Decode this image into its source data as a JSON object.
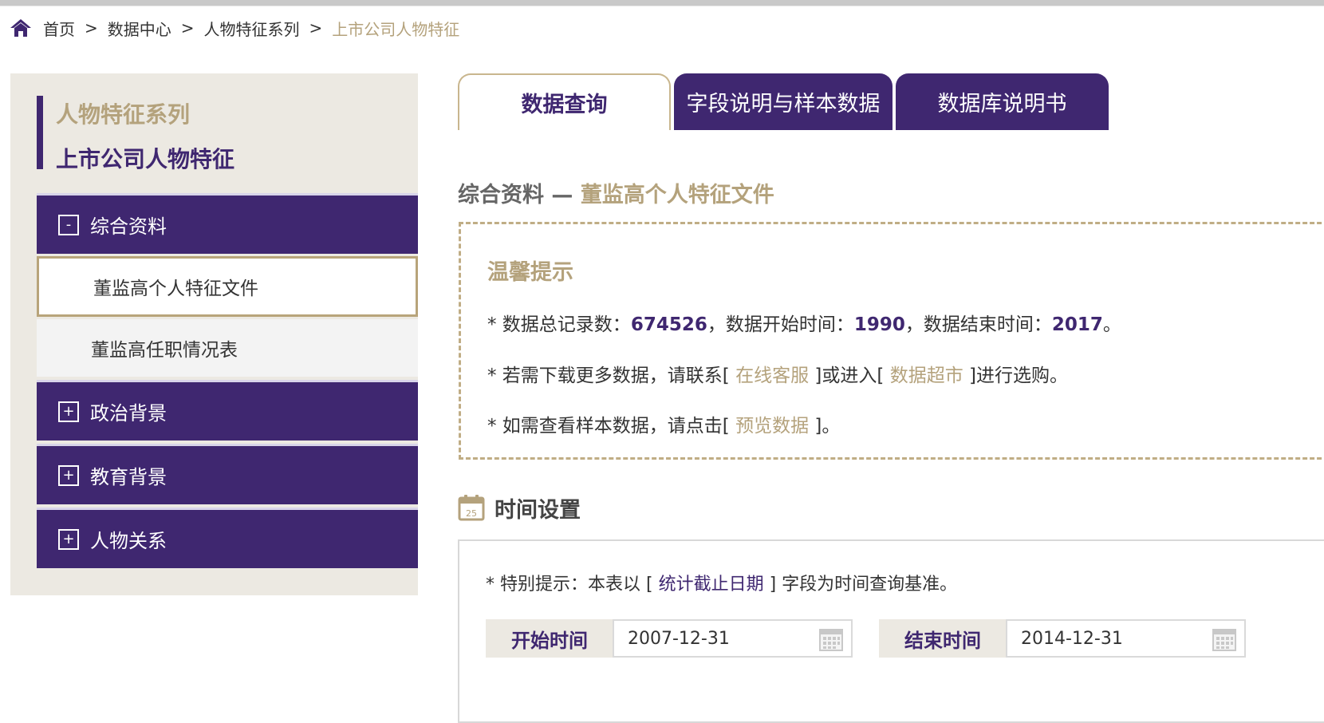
{
  "breadcrumb": {
    "icon": "home-icon",
    "items": [
      "首页",
      "数据中心",
      "人物特征系列",
      "上市公司人物特征"
    ],
    "separator": ">"
  },
  "sidebar": {
    "series_title": "人物特征系列",
    "db_title": "上市公司人物特征",
    "groups": [
      {
        "expander": "-",
        "label": "综合资料"
      },
      {
        "expander": "+",
        "label": "政治背景"
      },
      {
        "expander": "+",
        "label": "教育背景"
      },
      {
        "expander": "+",
        "label": "人物关系"
      }
    ],
    "sub_items": [
      "董监高个人特征文件",
      "董监高任职情况表"
    ]
  },
  "tabs": [
    "数据查询",
    "字段说明与样本数据",
    "数据库说明书"
  ],
  "section": {
    "prefix": "综合资料 — ",
    "highlight": "董监高个人特征文件"
  },
  "notice": {
    "title": "温馨提示",
    "line1": {
      "a": "* 数据总记录数：",
      "records": "674526",
      "b": "，数据开始时间：",
      "start_year": "1990",
      "c": "，数据结束时间：",
      "end_year": "2017",
      "d": "。"
    },
    "line2": {
      "a": "* 若需下载更多数据，请联系[ ",
      "link1": "在线客服",
      "b": " ]或进入[ ",
      "link2": "数据超市",
      "c": " ]进行选购。"
    },
    "line3": {
      "a": "* 如需查看样本数据，请点击[ ",
      "link": "预览数据",
      "b": " ]。"
    }
  },
  "time_settings": {
    "title": "时间设置",
    "calendar_day": "25",
    "tip": {
      "a": "* 特别提示：本表以 [ ",
      "field": "统计截止日期",
      "b": " ] 字段为时间查询基准。"
    },
    "start_label": "开始时间",
    "start_value": "2007-12-31",
    "end_label": "结束时间",
    "end_value": "2014-12-31"
  },
  "colors": {
    "brand_purple": "#3f2770",
    "accent_gold": "#b4a27c",
    "sidebar_bg": "#ece9e2"
  }
}
